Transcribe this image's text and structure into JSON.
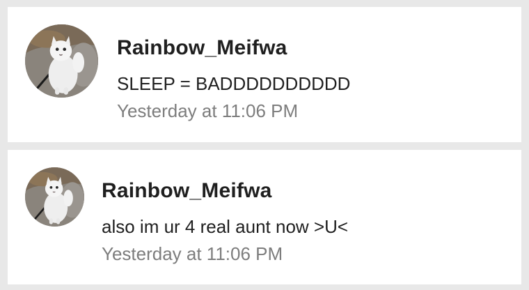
{
  "notifications": [
    {
      "username": "Rainbow_Meifwa",
      "message": "SLEEP = BADDDDDDDDDD",
      "timestamp": "Yesterday at 11:06 PM",
      "avatar_icon": "cat-avatar-icon"
    },
    {
      "username": "Rainbow_Meifwa",
      "message": "also im ur 4 real aunt now >U<",
      "timestamp": "Yesterday at 11:06 PM",
      "avatar_icon": "cat-avatar-icon"
    }
  ],
  "colors": {
    "background": "#e8e8e8",
    "card": "#ffffff",
    "text": "#1f1f1f",
    "muted": "#7d7d7d"
  }
}
